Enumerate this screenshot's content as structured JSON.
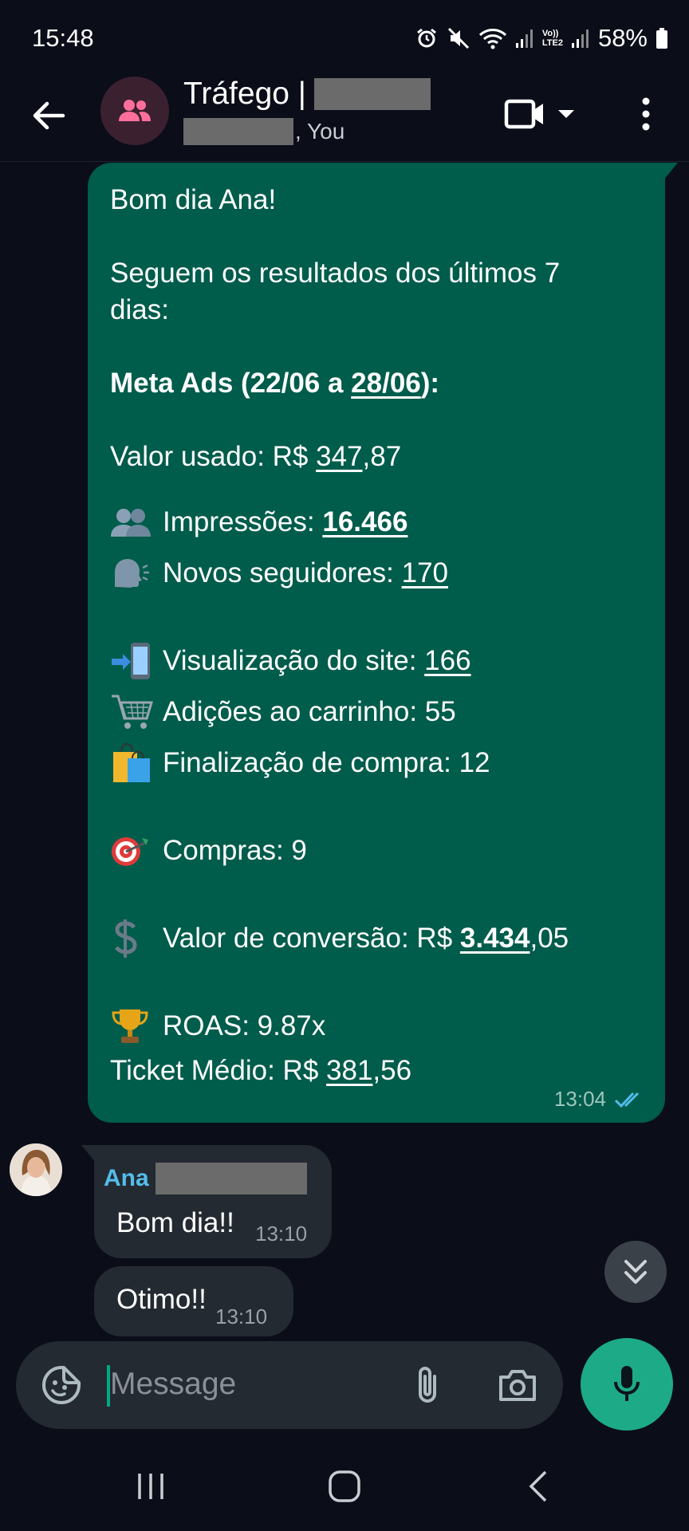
{
  "status_bar": {
    "time": "15:48",
    "battery": "58%",
    "lte_label": "LTE2"
  },
  "header": {
    "title": "Tráfego |",
    "subtitle_suffix": ", You"
  },
  "outgoing_message": {
    "greeting": "Bom dia Ana!",
    "intro": "Seguem os resultados dos últimos 7",
    "intro2": "dias:",
    "heading_pre": "Meta Ads (22/06 a ",
    "heading_date": "28/06",
    "heading_post": "):",
    "spent_label": "Valor usado: R$ ",
    "spent_int": "347",
    "spent_dec": ",87",
    "impressions_label": "Impressões: ",
    "impressions_value": "16.466",
    "followers_label": "Novos seguidores: ",
    "followers_value": "170",
    "site_views_label": "Visualização do site: ",
    "site_views_value": "166",
    "cart_adds": "Adições ao carrinho: 55",
    "checkouts": "Finalização de compra: 12",
    "purchases": "Compras: 9",
    "conversion_label": "Valor de conversão: R$ ",
    "conversion_int": "3.434",
    "conversion_dec": ",05",
    "roas": "ROAS: 9.87x",
    "ticket_label": "Ticket Médio: R$ ",
    "ticket_int": "381",
    "ticket_dec": ",56",
    "time": "13:04"
  },
  "incoming_messages": [
    {
      "sender": "Ana",
      "text": "Bom dia!!",
      "time": "13:10"
    },
    {
      "text": "Otimo!!",
      "time": "13:10"
    }
  ],
  "composer": {
    "placeholder": "Message"
  },
  "colors": {
    "outgoing_bubble": "#005c4b",
    "incoming_bubble": "#242a31",
    "accent": "#00a884",
    "sender_name": "#53bdeb",
    "read_ticks": "#53bdeb"
  }
}
